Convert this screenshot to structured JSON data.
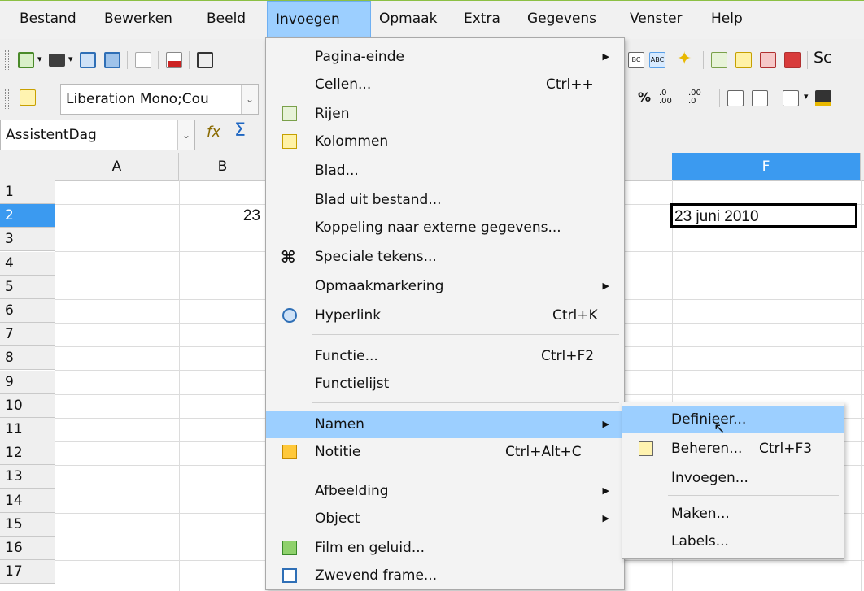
{
  "menubar": {
    "items": [
      {
        "label": "Bestand"
      },
      {
        "label": "Bewerken"
      },
      {
        "label": "Beeld"
      },
      {
        "label": "Invoegen"
      },
      {
        "label": "Opmaak"
      },
      {
        "label": "Extra"
      },
      {
        "label": "Gegevens"
      },
      {
        "label": "Venster"
      },
      {
        "label": "Help"
      }
    ]
  },
  "toolbar2": {
    "font_name": "Liberation Mono;Cou",
    "right_text": "Sc"
  },
  "formula_bar": {
    "name_box": "AssistentDag"
  },
  "grid": {
    "columns": [
      "A",
      "B",
      "F"
    ],
    "rows": [
      "1",
      "2",
      "3",
      "4",
      "5",
      "6",
      "7",
      "8",
      "9",
      "10",
      "11",
      "12",
      "13",
      "14",
      "15",
      "16",
      "17"
    ],
    "cell_b2": "23",
    "cell_f2": "23 juni 2010"
  },
  "insert_menu": {
    "items": [
      {
        "label": "Pagina-einde",
        "shortcut": "",
        "submenu": true
      },
      {
        "label": "Cellen...",
        "shortcut": "Ctrl++",
        "submenu": false
      },
      {
        "label": "Rijen",
        "shortcut": "",
        "submenu": false
      },
      {
        "label": "Kolommen",
        "shortcut": "",
        "submenu": false
      },
      {
        "label": "Blad...",
        "shortcut": "",
        "submenu": false
      },
      {
        "label": "Blad uit bestand...",
        "shortcut": "",
        "submenu": false
      },
      {
        "label": "Koppeling naar externe gegevens...",
        "shortcut": "",
        "submenu": false
      },
      {
        "label": "Speciale tekens...",
        "shortcut": "",
        "submenu": false
      },
      {
        "label": "Opmaakmarkering",
        "shortcut": "",
        "submenu": true
      },
      {
        "label": "Hyperlink",
        "shortcut": "Ctrl+K",
        "submenu": false
      },
      {
        "label": "Functie...",
        "shortcut": "Ctrl+F2",
        "submenu": false
      },
      {
        "label": "Functielijst",
        "shortcut": "",
        "submenu": false
      },
      {
        "label": "Namen",
        "shortcut": "",
        "submenu": true
      },
      {
        "label": "Notitie",
        "shortcut": "Ctrl+Alt+C",
        "submenu": false
      },
      {
        "label": "Afbeelding",
        "shortcut": "",
        "submenu": true
      },
      {
        "label": "Object",
        "shortcut": "",
        "submenu": true
      },
      {
        "label": "Film en geluid...",
        "shortcut": "",
        "submenu": false
      },
      {
        "label": "Zwevend frame...",
        "shortcut": "",
        "submenu": false
      }
    ]
  },
  "names_submenu": {
    "items": [
      {
        "label": "Definieer...",
        "shortcut": ""
      },
      {
        "label": "Beheren...",
        "shortcut": "Ctrl+F3"
      },
      {
        "label": "Invoegen...",
        "shortcut": ""
      },
      {
        "label": "Maken...",
        "shortcut": ""
      },
      {
        "label": "Labels...",
        "shortcut": ""
      }
    ]
  },
  "colors": {
    "highlight": "#9ccfff",
    "menu_bg": "#f3f3f3",
    "selected_col": "#3b9af0"
  }
}
